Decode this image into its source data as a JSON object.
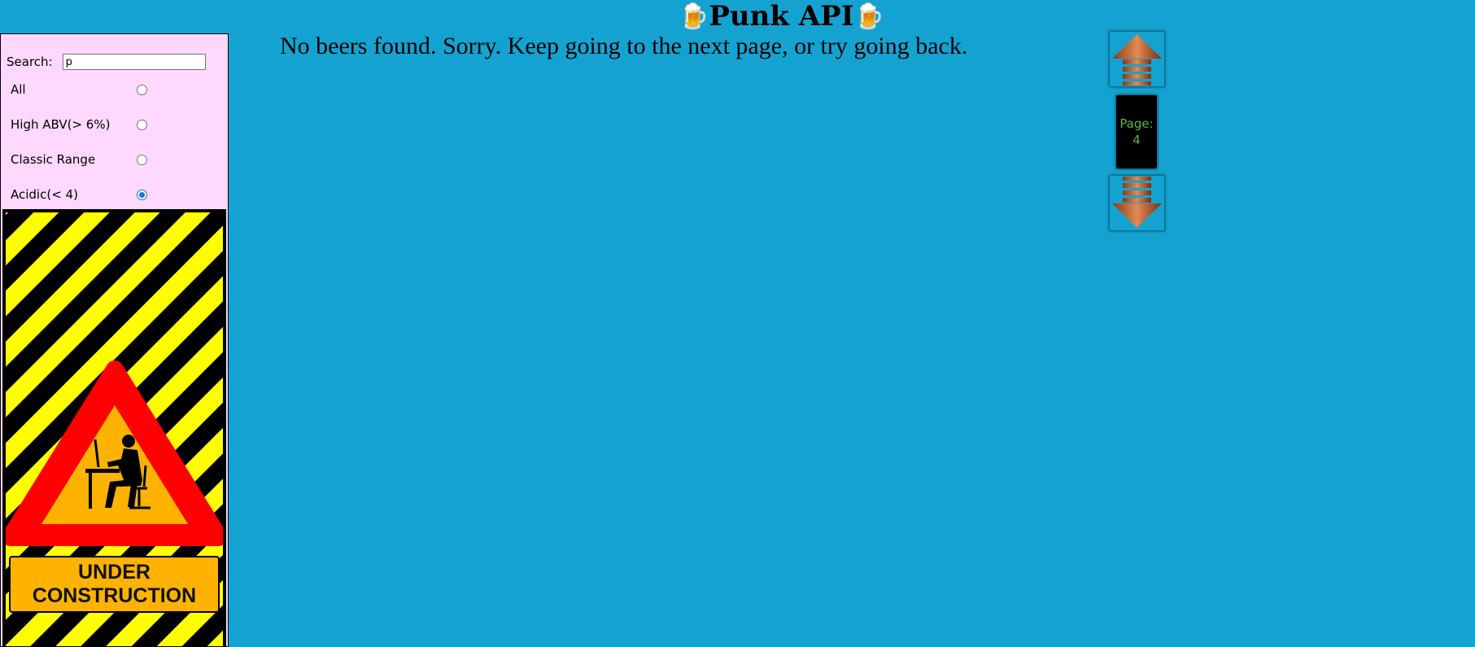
{
  "header": {
    "title": "Punk API",
    "left_icon": "beer-mug-icon",
    "right_icon": "beer-mug-icon"
  },
  "sidebar": {
    "search_label": "Search:",
    "search_value": "p",
    "filters": [
      {
        "label": "All",
        "checked": false
      },
      {
        "label": "High ABV(> 6%)",
        "checked": false
      },
      {
        "label": "Classic Range",
        "checked": false
      },
      {
        "label": "Acidic(< 4)",
        "checked": true
      }
    ],
    "construction_text_line1": "UNDER",
    "construction_text_line2": "CONSTRUCTION",
    "background_color": "#ffd8ff"
  },
  "main": {
    "message": "No beers found. Sorry. Keep going to the next page, or try going back."
  },
  "pagination": {
    "page_label": "Page:",
    "page_number": "4",
    "up_icon": "arrow-up-icon",
    "down_icon": "arrow-down-icon"
  },
  "colors": {
    "page_background": "#14a3d1",
    "page_counter_text": "#5fb33d",
    "radio_checked": "#1a73e8"
  }
}
